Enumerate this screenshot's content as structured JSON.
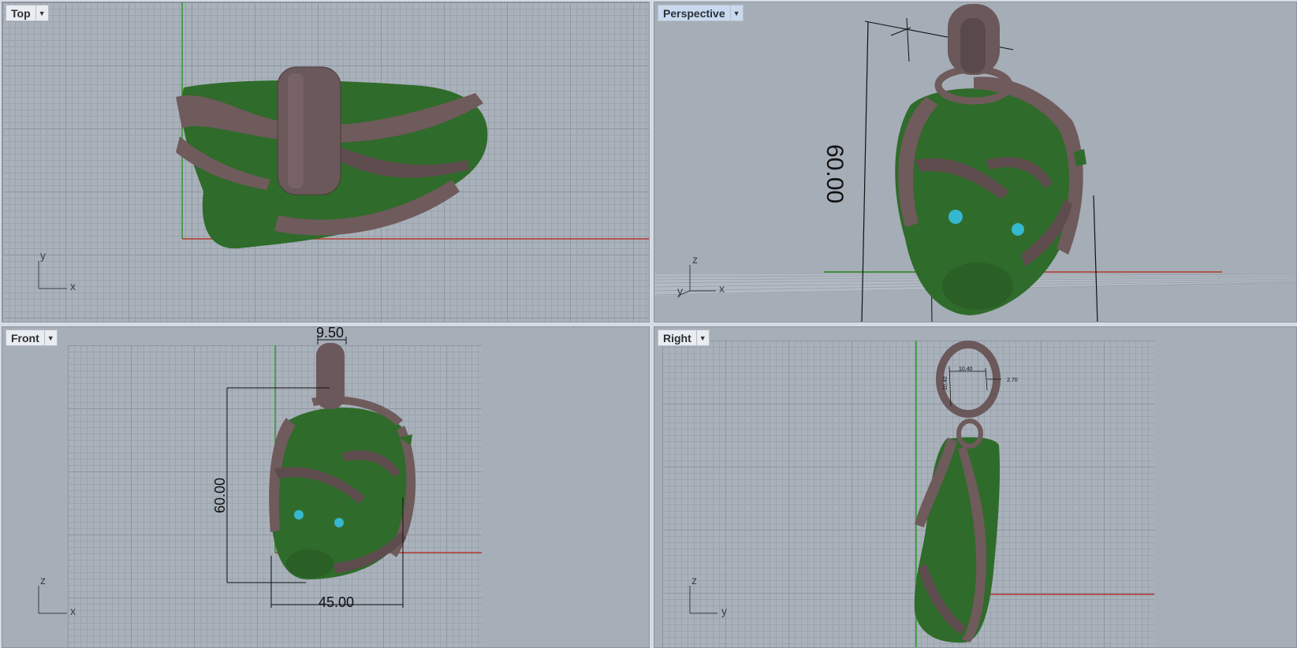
{
  "viewports": {
    "top": {
      "label": "Top",
      "axes": {
        "h": "x",
        "v": "y"
      }
    },
    "perspective": {
      "label": "Perspective",
      "axes": {
        "h": "x",
        "v": "z",
        "d": "y"
      },
      "dimension": "60.00"
    },
    "front": {
      "label": "Front",
      "axes": {
        "h": "x",
        "v": "z"
      },
      "dim_top": "9.50",
      "dim_height": "60.00",
      "dim_width": "45.00"
    },
    "right": {
      "label": "Right",
      "axes": {
        "h": "y",
        "v": "z"
      },
      "dim_inner": "10.40",
      "dim_side": "2.70",
      "dim_vert": "10.40"
    }
  },
  "colors": {
    "green": "#2f6b2a",
    "bronze": "#6f5a5c",
    "eye": "#35b8cf",
    "x_axis": "#b33a2c",
    "y_axis": "#2a9a2a"
  }
}
